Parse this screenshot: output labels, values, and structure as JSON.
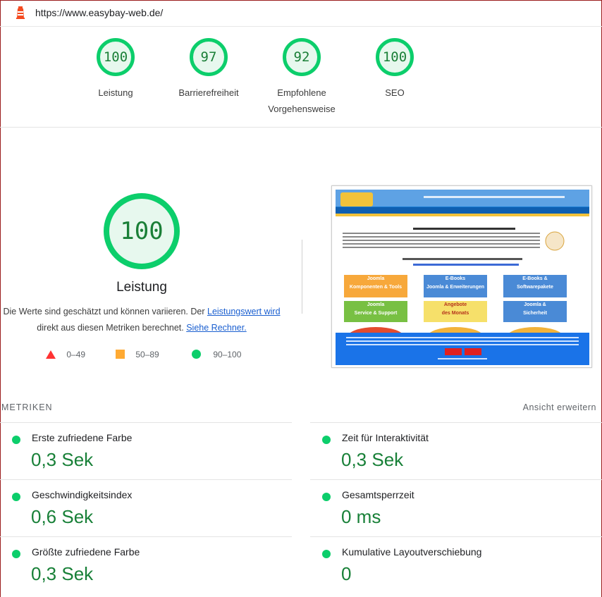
{
  "url": "https://www.easybay-web.de/",
  "gauges": [
    {
      "score": "100",
      "label_line1": "Leistung",
      "label_line2": ""
    },
    {
      "score": "97",
      "label_line1": "Barrierefreiheit",
      "label_line2": ""
    },
    {
      "score": "92",
      "label_line1": "Empfohlene",
      "label_line2": "Vorgehensweise"
    },
    {
      "score": "100",
      "label_line1": "SEO",
      "label_line2": ""
    }
  ],
  "performance": {
    "score": "100",
    "title": "Leistung",
    "desc_text1": "Die Werte sind geschätzt und können variieren. Der ",
    "desc_link1": "Leistungswert wird",
    "desc_text2": " direkt aus diesen Metriken berechnet. ",
    "desc_link2": "Siehe Rechner."
  },
  "legend": [
    {
      "range": "0–49",
      "icon": "red-triangle-icon",
      "color": "#ff3333"
    },
    {
      "range": "50–89",
      "icon": "orange-square-icon",
      "color": "#ffaa33"
    },
    {
      "range": "90–100",
      "icon": "green-circle-icon",
      "color": "#0cce6b"
    }
  ],
  "metrics_section": {
    "title": "METRIKEN",
    "expand": "Ansicht erweitern"
  },
  "metrics": [
    {
      "label": "Erste zufriedene Farbe",
      "value": "0,3 Sek"
    },
    {
      "label": "Zeit für Interaktivität",
      "value": "0,3 Sek"
    },
    {
      "label": "Geschwindigkeitsindex",
      "value": "0,6 Sek"
    },
    {
      "label": "Gesamtsperrzeit",
      "value": "0 ms"
    },
    {
      "label": "Größte zufriedene Farbe",
      "value": "0,3 Sek"
    },
    {
      "label": "Kumulative Layoutverschiebung",
      "value": "0"
    }
  ],
  "screenshot": {
    "tiles": [
      {
        "line1": "Joomla",
        "line2": "Komponenten & Tools"
      },
      {
        "line1": "E-Books",
        "line2": "Joomla & Erweiterungen"
      },
      {
        "line1": "E-Books &",
        "line2": "Softwarepakete"
      },
      {
        "line1": "Joomla",
        "line2": "Service & Support"
      },
      {
        "line1": "Angebote",
        "line2": "des Monats"
      },
      {
        "line1": "Joomla &",
        "line2": "Sicherheit"
      }
    ]
  },
  "colors": {
    "pass": "#0cce6b",
    "pass_text": "#188038"
  }
}
